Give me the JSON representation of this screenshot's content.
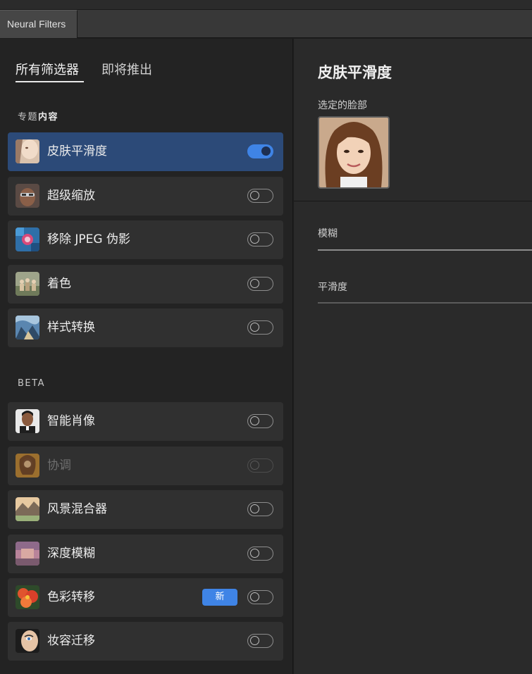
{
  "panel": {
    "tab_label": "Neural Filters"
  },
  "tabs": [
    {
      "label": "所有筛选器",
      "active": true
    },
    {
      "label": "即将推出",
      "active": false
    }
  ],
  "sections": {
    "featured": {
      "label_prefix": "专题",
      "label_bold": "内容"
    },
    "beta": {
      "label": "BETA"
    }
  },
  "featured_filters": [
    {
      "name": "皮肤平滑度",
      "icon": "skin-smoothing-icon",
      "enabled": true,
      "selected": true
    },
    {
      "name": "超级缩放",
      "icon": "super-zoom-icon",
      "enabled": false
    },
    {
      "name": "移除 JPEG 伪影",
      "icon": "jpeg-artifacts-icon",
      "enabled": false
    },
    {
      "name": "着色",
      "icon": "colorize-icon",
      "enabled": false
    },
    {
      "name": "样式转换",
      "icon": "style-transfer-icon",
      "enabled": false
    }
  ],
  "beta_filters": [
    {
      "name": "智能肖像",
      "icon": "smart-portrait-icon",
      "enabled": false
    },
    {
      "name": "协调",
      "icon": "harmonization-icon",
      "enabled": false,
      "disabled": true
    },
    {
      "name": "风景混合器",
      "icon": "landscape-mixer-icon",
      "enabled": false
    },
    {
      "name": "深度模糊",
      "icon": "depth-blur-icon",
      "enabled": false
    },
    {
      "name": "色彩转移",
      "icon": "color-transfer-icon",
      "enabled": false,
      "badge": "新"
    },
    {
      "name": "妆容迁移",
      "icon": "makeup-transfer-icon",
      "enabled": false
    }
  ],
  "detail": {
    "title": "皮肤平滑度",
    "selected_face_label": "选定的脸部",
    "sliders": [
      {
        "label": "模糊"
      },
      {
        "label": "平滑度"
      }
    ]
  },
  "colors": {
    "accent": "#3f84e6",
    "selected_row": "#2c4a78",
    "row_bg": "#303030",
    "panel_bg": "#232323"
  }
}
